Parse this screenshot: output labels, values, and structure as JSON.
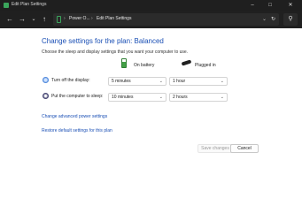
{
  "window": {
    "title": "Edit Plan Settings"
  },
  "address_bar": {
    "crumbs": [
      "Power O...",
      "Edit Plan Settings"
    ]
  },
  "content": {
    "heading": "Change settings for the plan: Balanced",
    "subtitle": "Choose the sleep and display settings that you want your computer to use.",
    "columns": {
      "on_battery": "On battery",
      "plugged_in": "Plugged in"
    },
    "rows": [
      {
        "label": "Turn off the display:",
        "on_battery": "5 minutes",
        "plugged_in": "1 hour"
      },
      {
        "label": "Put the computer to sleep:",
        "on_battery": "10 minutes",
        "plugged_in": "2 hours"
      }
    ],
    "links": {
      "advanced": "Change advanced power settings",
      "restore": "Restore default settings for this plan"
    },
    "buttons": {
      "save": "Save changes",
      "cancel": "Cancel"
    }
  },
  "colors": {
    "link": "#1a4fb5",
    "titlebar": "#1f1f1f",
    "accent_green": "#3ba55c"
  }
}
